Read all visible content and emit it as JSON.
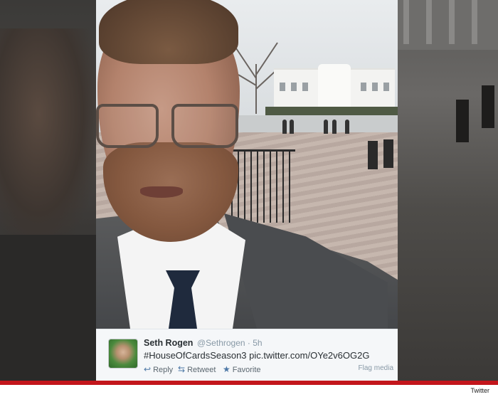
{
  "tweet": {
    "name": "Seth Rogen",
    "handle": "@Sethrogen",
    "time": "· 5h",
    "text": "#HouseOfCardsSeason3 pic.twitter.com/OYe2v6OG2G",
    "actions": {
      "reply": "Reply",
      "retweet": "Retweet",
      "favorite": "Favorite"
    },
    "flag_label": "Flag media"
  },
  "credit": "Twitter",
  "icons": {
    "reply": "reply-arrow-icon",
    "retweet": "retweet-icon",
    "favorite": "star-icon"
  },
  "colors": {
    "brand_bar": "#c3161c",
    "link_blue": "#4d78a6"
  }
}
